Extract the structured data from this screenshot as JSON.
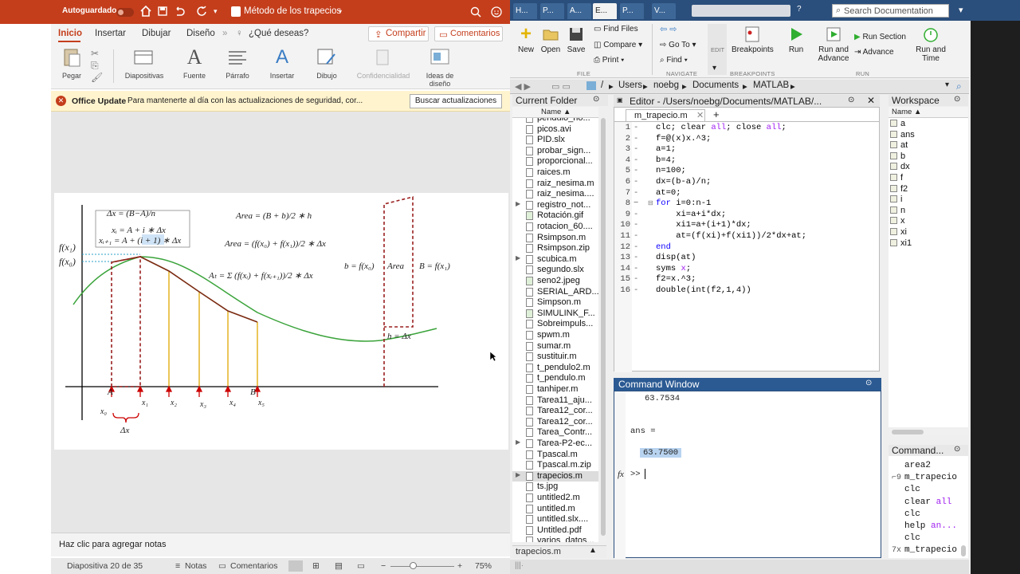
{
  "ppt": {
    "autosave": "Autoguardado",
    "autosave_state": "Off",
    "doc_title": "Método de los trapecios",
    "tabs": [
      "Inicio",
      "Insertar",
      "Dibujar",
      "Diseño"
    ],
    "tell_me": "¿Qué deseas?",
    "share": "Compartir",
    "comments": "Comentarios",
    "ribbon": [
      "Pegar",
      "Diapositivas",
      "Fuente",
      "Párrafo",
      "Insertar",
      "Dibujo",
      "Confidencialidad",
      "Ideas de diseño"
    ],
    "notice_title": "Office Update",
    "notice_text": "Para mantenerte al día con las actualizaciones de seguridad, cor...",
    "notice_button": "Buscar actualizaciones",
    "notes_placeholder": "Haz clic para agregar notas",
    "status_slide": "Diapositiva 20 de 35",
    "status_notes": "Notas",
    "status_comments": "Comentarios",
    "zoom": "75%",
    "slide": {
      "fx1": "f(x₁)",
      "fx0": "f(x₀)",
      "dx_frac": "Δx = (B−A)/n",
      "xi": "xᵢ = A + i ∗ Δx",
      "xi1": "xᵢ₊₁ = A + (i + 1) ∗ Δx",
      "area1": "Area = (B + b)/2 ∗ h",
      "area2": "Area = (f(x₀) + f(x₁))/2 ∗ Δx",
      "at": "Aₜ = Σ (f(xᵢ) + f(xᵢ₊₁))/2 ∗ Δx",
      "b_label": "b = f(x₀)",
      "area_box": "Area",
      "B_label": "B = f(x₁)",
      "h_label": "h = Δx",
      "x_ticks": [
        "x₀",
        "x₁",
        "x₂",
        "x₃",
        "x₄",
        "x₅"
      ],
      "A": "A",
      "B": "B",
      "dx": "Δx"
    }
  },
  "matlab": {
    "tabs": [
      "H...",
      "P...",
      "A...",
      "E...",
      "P...",
      "V..."
    ],
    "search_placeholder": "Search Documentation",
    "file": {
      "new": "New",
      "open": "Open",
      "save": "Save",
      "find_files": "Find Files",
      "compare": "Compare",
      "print": "Print",
      "section": "FILE"
    },
    "navigate": {
      "go_to": "Go To",
      "find": "Find",
      "section": "NAVIGATE"
    },
    "edit": "EDIT",
    "breakpoints": {
      "label": "Breakpoints",
      "section": "BREAKPOINTS"
    },
    "run": {
      "run": "Run",
      "run_advance": "Run and Advance",
      "run_section": "Run Section",
      "advance": "Advance",
      "run_time": "Run and Time",
      "section": "RUN"
    },
    "path": [
      "/",
      "Users",
      "noebg",
      "Documents",
      "MATLAB"
    ],
    "current_folder_title": "Current Folder",
    "name_col": "Name ▲",
    "files": [
      "pendulo_no...",
      "picos.avi",
      "PID.slx",
      "probar_sign...",
      "proporcional...",
      "raices.m",
      "raiz_nesima.m",
      "raiz_nesima....",
      "registro_not...",
      "Rotación.gif",
      "rotacion_60....",
      "Rsimpson.m",
      "Rsimpson.zip",
      "scubica.m",
      "segundo.slx",
      "seno2.jpeg",
      "SERIAL_ARD...",
      "Simpson.m",
      "SIMULINK_F...",
      "Sobreimpuls...",
      "spwm.m",
      "sumar.m",
      "sustituir.m",
      "t_pendulo2.m",
      "t_pendulo.m",
      "tanhiper.m",
      "Tarea11_aju...",
      "Tarea12_cor...",
      "Tarea12_cor...",
      "Tarea_Contr...",
      "Tarea-P2-ec...",
      "Tpascal.m",
      "Tpascal.m.zip",
      "trapecios.m",
      "ts.jpg",
      "untitled2.m",
      "untitled.m",
      "untitled.slx....",
      "Untitled.pdf",
      "varios_datos..."
    ],
    "folder_footer": "trapecios.m",
    "editor_title": "Editor - /Users/noebg/Documents/MATLAB/...",
    "editor_tab": "m_trapecio.m",
    "code": [
      "clc; clear all; close all;",
      "f=@(x)x.^3;",
      "a=1;",
      "b=4;",
      "n=100;",
      "dx=(b-a)/n;",
      "at=0;",
      "for i=0:n-1",
      "    xi=a+i*dx;",
      "    xi1=a+(i+1)*dx;",
      "    at=(f(xi)+f(xi1))/2*dx+at;",
      "end",
      "disp(at)",
      "syms x;",
      "f2=x.^3;",
      "double(int(f2,1,4))"
    ],
    "command_window_title": "Command Window",
    "cmd_out1": "63.7534",
    "cmd_ans": "ans =",
    "cmd_out2": "63.7500",
    "prompt": ">>",
    "workspace_title": "Workspace",
    "ws_name_col": "Name ▲",
    "ws_vars": [
      "a",
      "ans",
      "at",
      "b",
      "dx",
      "f",
      "f2",
      "i",
      "n",
      "x",
      "xi",
      "xi1"
    ],
    "history_title": "Command...",
    "history": [
      "area2",
      "m_trapecio",
      "clc",
      "clear all",
      "clc",
      "help an...",
      "clc",
      "m_trapecio"
    ],
    "history_marks": [
      "",
      "⌐9",
      "",
      "",
      "",
      "",
      "",
      "7x"
    ]
  }
}
